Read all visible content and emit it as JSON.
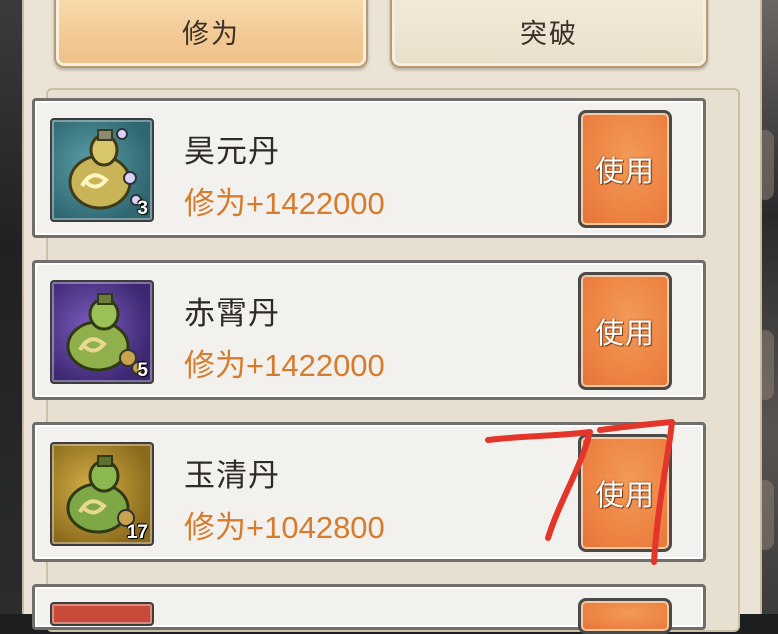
{
  "tabs": [
    {
      "label": "修为",
      "active": true
    },
    {
      "label": "突破",
      "active": false
    }
  ],
  "items": [
    {
      "name": "昊元丹",
      "effect": "修为+1422000",
      "count": "3",
      "icon": "gourd-bottle-icon",
      "bg": "#3e7a86",
      "action": "使用"
    },
    {
      "name": "赤霄丹",
      "effect": "修为+1422000",
      "count": "5",
      "icon": "gourd-bottle-icon",
      "bg": "#5a3d93",
      "action": "使用"
    },
    {
      "name": "玉清丹",
      "effect": "修为+1042800",
      "count": "17",
      "icon": "gourd-bottle-icon",
      "bg": "#b08a2c",
      "action": "使用"
    }
  ],
  "annotation": {
    "text": "77",
    "color": "#e4352a"
  },
  "colors": {
    "accent": "#ee8544",
    "effect_text": "#d77b2c",
    "panel": "#ebe4d6"
  }
}
